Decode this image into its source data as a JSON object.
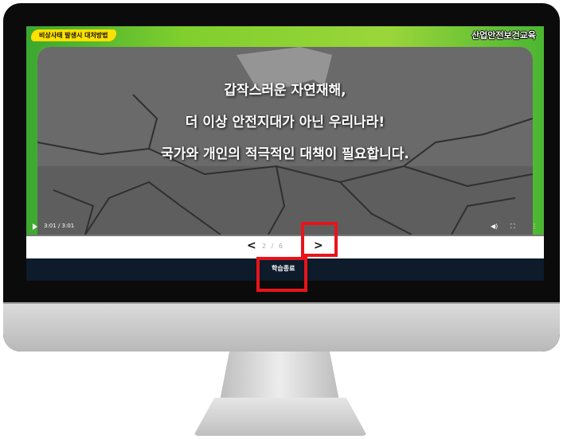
{
  "video": {
    "category_tag": "비상사태 발생시 대처방법",
    "brand": "산업안전보건교육",
    "lines": [
      "갑작스러운 자연재해,",
      "더 이상 안전지대가 아닌 우리나라!",
      "국가와 개인의 적극적인 대책이 필요합니다."
    ],
    "time": "3:01 / 3:01"
  },
  "pager": {
    "prev": "<",
    "next": ">",
    "count": "2 / 6"
  },
  "footer": {
    "finish_label": "학습종료"
  },
  "icons": [
    "play-icon",
    "volume-icon",
    "fullscreen-icon",
    "more-icon"
  ],
  "colors": {
    "highlight": "#e8141b",
    "footer_bg": "#0d1b2a",
    "tag_bg": "#ffe000"
  }
}
